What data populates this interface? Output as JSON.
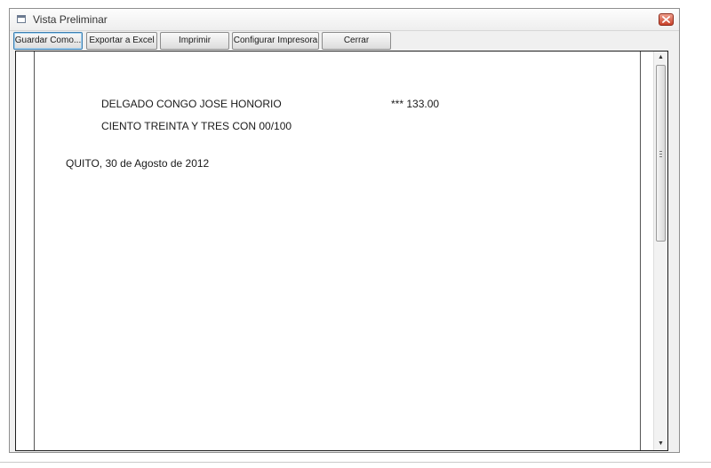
{
  "window": {
    "title": "Vista Preliminar"
  },
  "toolbar": {
    "buttons": [
      {
        "label": "Guardar Como..."
      },
      {
        "label": "Exportar a Excel"
      },
      {
        "label": "Imprimir"
      },
      {
        "label": "Configurar Impresora"
      },
      {
        "label": "Cerrar"
      }
    ]
  },
  "document": {
    "payee": "DELGADO CONGO JOSE HONORIO",
    "amount": "*** 133.00",
    "amount_words": "CIENTO TREINTA Y TRES CON 00/100",
    "place_date": "QUITO, 30 de Agosto de 2012"
  },
  "icons": {
    "window": "window-icon",
    "close": "close-icon",
    "scroll_up": "scroll-up-arrow-icon",
    "scroll_down": "scroll-down-arrow-icon",
    "grip": "scroll-grip-icon"
  },
  "colors": {
    "close_button": "#c8412a",
    "focus_border": "#3c7fb1"
  }
}
